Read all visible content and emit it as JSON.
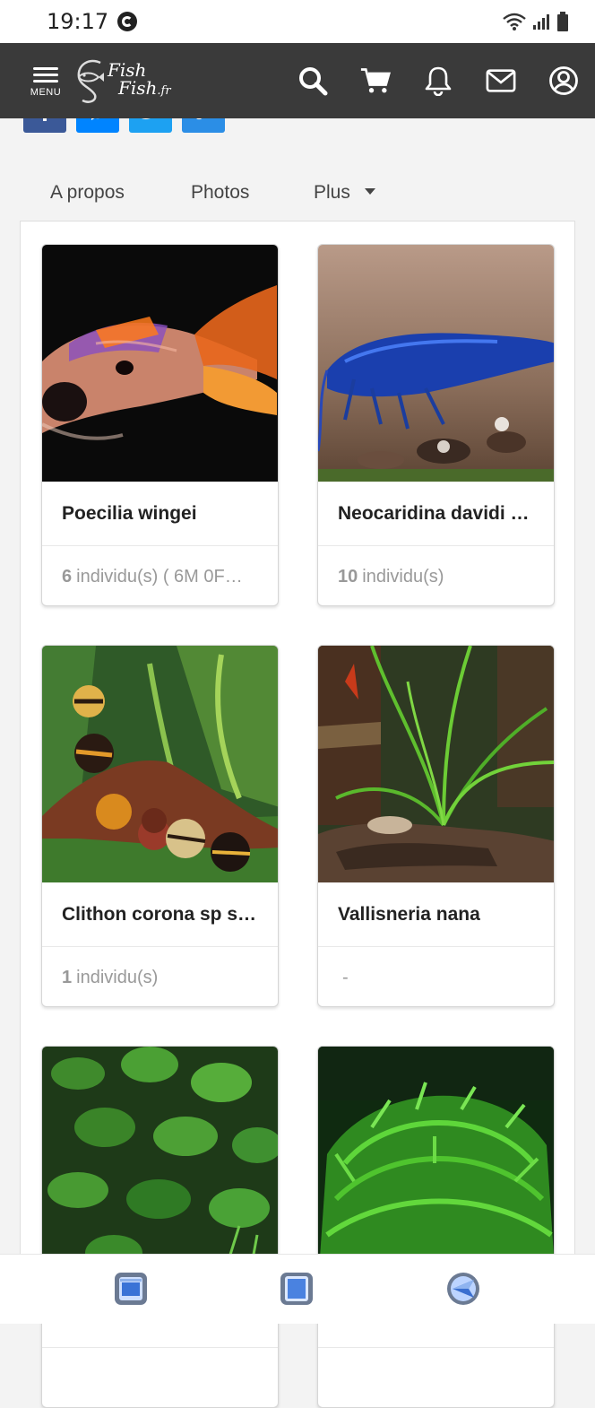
{
  "status_bar": {
    "time": "19:17",
    "icons": [
      "wifi-icon",
      "signal-icon",
      "battery-icon"
    ]
  },
  "navbar": {
    "menu_label": "MENU",
    "logo_line1": "Fish",
    "logo_line2": "Fish",
    "logo_suffix": ".fr",
    "icons": [
      "search-icon",
      "cart-icon",
      "bell-icon",
      "mail-icon",
      "user-icon"
    ]
  },
  "social": {
    "buttons": [
      "facebook-icon",
      "messenger-icon",
      "twitter-icon",
      "link-icon"
    ],
    "colors": {
      "facebook": "#3b5998",
      "messenger": "#0084ff",
      "twitter": "#1da1f2",
      "link": "#2b8ee6"
    }
  },
  "tabs": {
    "about": "A propos",
    "photos": "Photos",
    "more": "Plus"
  },
  "cards": [
    {
      "title": "Poecilia wingei",
      "count": "6",
      "subtitle": "individu(s) ( 6M 0F…",
      "image": "poecilia-wingei-photo"
    },
    {
      "title": "Neocaridina davidi …",
      "count": "10",
      "subtitle": "individu(s)",
      "image": "neocaridina-davidi-photo"
    },
    {
      "title": "Clithon corona sp s…",
      "count": "1",
      "subtitle": "individu(s)",
      "image": "clithon-corona-photo"
    },
    {
      "title": "Vallisneria nana",
      "count": "",
      "subtitle": "-",
      "image": "vallisneria-nana-photo"
    },
    {
      "title": "",
      "count": "",
      "subtitle": "",
      "image": "anubias-plant-photo"
    },
    {
      "title": "",
      "count": "",
      "subtitle": "",
      "image": "moss-plant-photo"
    }
  ],
  "system_nav": [
    "recents-button",
    "home-button",
    "back-button"
  ]
}
